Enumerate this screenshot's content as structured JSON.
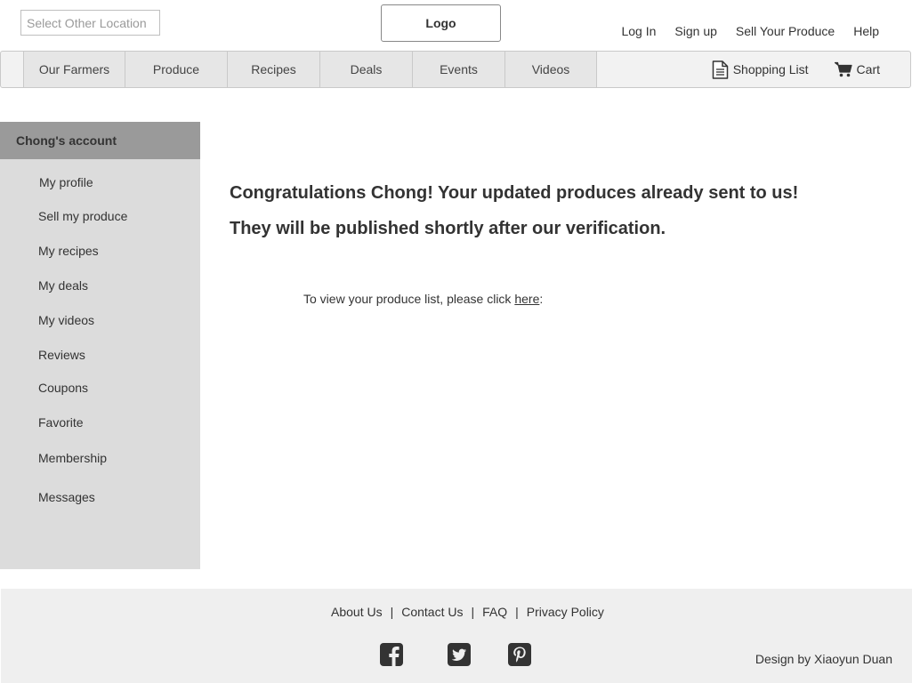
{
  "header": {
    "location_placeholder": "Select Other Location",
    "logo": "Logo",
    "links": [
      "Log In",
      "Sign up",
      "Sell Your Produce",
      "Help"
    ]
  },
  "nav": {
    "tabs": [
      "Our Farmers",
      "Produce",
      "Recipes",
      "Deals",
      "Events",
      "Videos"
    ],
    "shopping_list": "Shopping List",
    "cart": "Cart"
  },
  "sidebar": {
    "title": "Chong's account",
    "items": [
      "My profile",
      "Sell my produce",
      "My recipes",
      "My deals",
      "My videos",
      "Reviews",
      "Coupons",
      "Favorite",
      "Membership",
      "Messages"
    ]
  },
  "main": {
    "message_line1": "Congratulations Chong! Your updated produces already sent to us!",
    "message_line2": "They will be published shortly after our verification.",
    "view_prefix": "To view your produce list, please click ",
    "view_link": "here",
    "view_suffix": ":"
  },
  "footer": {
    "links": [
      "About Us",
      "Contact Us",
      "FAQ",
      "Privacy Policy"
    ],
    "separator": "|",
    "credit": "Design by Xiaoyun Duan"
  },
  "colors": {
    "sidebar_header": "#9a9a9a",
    "sidebar_bg": "#dcdcdc",
    "nav_tab_bg": "#e6e6e6",
    "footer_bg": "#efefef",
    "text": "#333333"
  }
}
